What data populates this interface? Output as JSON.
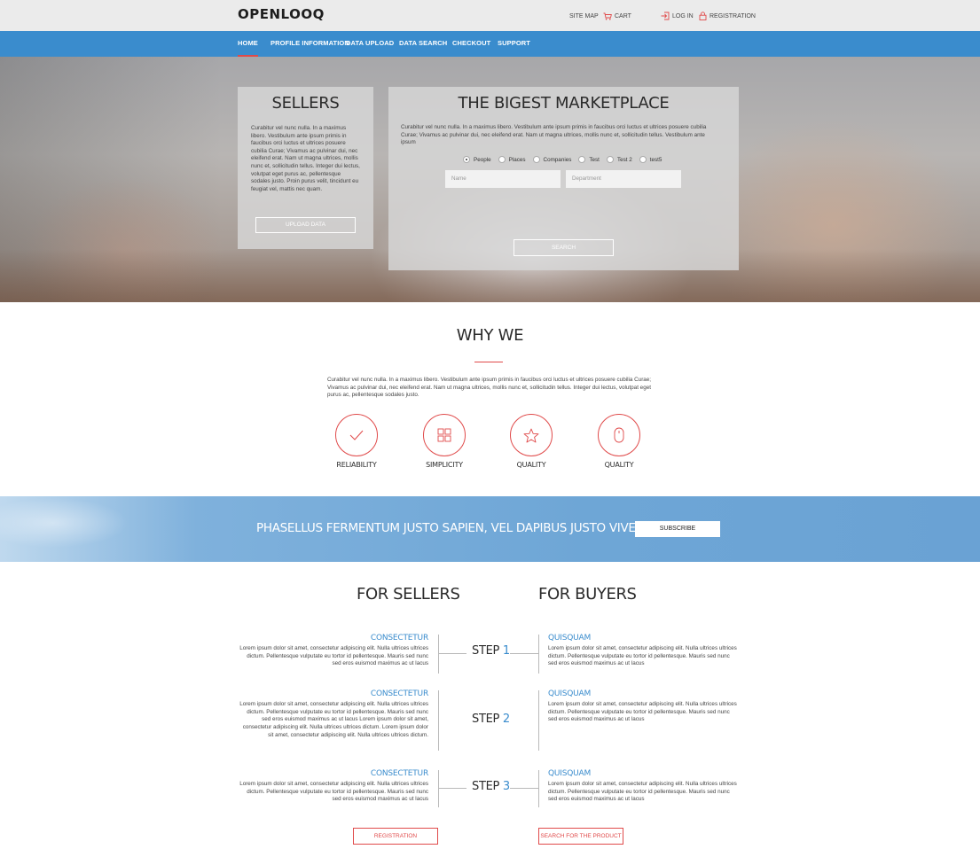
{
  "header": {
    "logo": "OPENLOOQ",
    "links": {
      "sitemap": "SITE MAP",
      "cart": "CART",
      "login": "LOG IN",
      "registration": "REGISTRATION"
    },
    "icons": {
      "cart": "cart-icon",
      "login": "login-icon",
      "registration": "lock-icon"
    }
  },
  "nav": {
    "items": [
      "HOME",
      "PROFILE INFORMATION",
      "DATA UPLOAD",
      "DATA SEARCH",
      "CHECKOUT",
      "SUPPORT"
    ],
    "active": "HOME"
  },
  "hero": {
    "sellers": {
      "title": "SELLERS",
      "text": "Curabitur vel nunc nulla. In a maximus libero. Vestibulum ante ipsum primis in faucibus orci luctus et ultrices posuere cubilia Curae; Vivamus ac pulvinar dui, nec eleifend erat. Nam ut magna ultrices, mollis nunc et, sollicitudin tellus. Integer dui lectus, volutpat eget purus ac, pellentesque sodales justo. Proin purus velit, tincidunt eu feugiat vel, mattis nec quam.",
      "button": "UPLOAD DATA"
    },
    "market": {
      "title": "THE BIGEST MARKETPLACE",
      "text": "Curabitur vel nunc nulla. In a maximus libero. Vestibulum ante ipsum primis in faucibus orci luctus et ultrices posuere cubilia Curae; Vivamus ac pulvinar dui, nec eleifend erat. Nam ut magna ultrices, mollis nunc et, sollicitudin tellus. Vestibulum ante ipsum",
      "radios": [
        "People",
        "Places",
        "Companies",
        "Test",
        "Test 2",
        "test5"
      ],
      "selected": "People",
      "name_placeholder": "Name",
      "department_placeholder": "Department",
      "button": "SEARCH"
    }
  },
  "why": {
    "title": "WHY WE",
    "text": "Curabitur vel nunc nulla. In a maximus libero. Vestibulum ante ipsum primis in faucibus orci luctus et ultrices posuere cubilia Curae; Vivamus ac pulvinar dui, nec eleifend erat. Nam ut magna ultrices, mollis nunc et, sollicitudin tellus. Integer dui lectus, volutpat eget purus ac, pellentesque sodales justo.",
    "features": [
      {
        "label": "RELIABILITY",
        "icon": "checkmark-icon"
      },
      {
        "label": "SIMPLICITY",
        "icon": "grid-icon"
      },
      {
        "label": "QUALITY",
        "icon": "star-icon"
      },
      {
        "label": "QUALITY",
        "icon": "mouse-icon"
      }
    ]
  },
  "banner": {
    "text": "PHASELLUS FERMENTUM JUSTO SAPIEN, VEL DAPIBUS JUSTO VIVERRA EGET",
    "button": "SUBSCRIBE"
  },
  "steps": {
    "sellers_title": "FOR SELLERS",
    "buyers_title": "FOR BUYERS",
    "step_word": "STEP",
    "items": [
      {
        "number": "1",
        "seller_title": "CONSECTETUR",
        "seller_text": "Lorem ipsum dolor sit amet, consectetur adipiscing elit. Nulla ultrices ultrices dictum. Pellentesque vulputate eu tortor id pellentesque. Mauris sed nunc sed eros euismod maximus ac ut lacus",
        "buyer_title": "QUISQUAM",
        "buyer_text": "Lorem ipsum dolor sit amet, consectetur adipiscing elit. Nulla ultrices ultrices dictum. Pellentesque vulputate eu tortor id pellentesque. Mauris sed nunc sed eros euismod maximus ac ut lacus"
      },
      {
        "number": "2",
        "seller_title": "CONSECTETUR",
        "seller_text": "Lorem ipsum dolor sit amet, consectetur adipiscing elit. Nulla ultrices ultrices dictum. Pellentesque vulputate eu tortor id pellentesque. Mauris sed nunc sed eros euismod maximus ac ut lacus Lorem ipsum dolor sit amet, consectetur adipiscing elit. Nulla ultrices ultrices dictum. Lorem ipsum dolor sit amet, consectetur adipiscing elit. Nulla ultrices ultrices dictum.",
        "buyer_title": "QUISQUAM",
        "buyer_text": "Lorem ipsum dolor sit amet, consectetur adipiscing elit. Nulla ultrices ultrices dictum. Pellentesque vulputate eu tortor id pellentesque. Mauris sed nunc sed eros euismod maximus ac ut lacus"
      },
      {
        "number": "3",
        "seller_title": "CONSECTETUR",
        "seller_text": "Lorem ipsum dolor sit amet, consectetur adipiscing elit. Nulla ultrices ultrices dictum. Pellentesque vulputate eu tortor id pellentesque. Mauris sed nunc sed eros euismod maximus ac ut lacus",
        "buyer_title": "QUISQUAM",
        "buyer_text": "Lorem ipsum dolor sit amet, consectetur adipiscing elit. Nulla ultrices ultrices dictum. Pellentesque vulputate eu tortor id pellentesque. Mauris sed nunc sed eros euismod maximus ac ut lacus"
      }
    ],
    "registration_button": "REGISTRATION",
    "search_product_button": "SEARCH FOR THE PRODUCT"
  },
  "colors": {
    "accent_blue": "#3a8ccd",
    "accent_red": "#e04a4a",
    "topbar": "#ebebeb"
  }
}
